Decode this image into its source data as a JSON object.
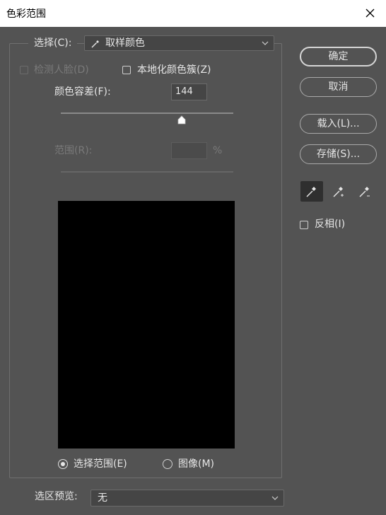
{
  "window": {
    "title": "色彩范围"
  },
  "select": {
    "label": "选择(C):",
    "value": "取样颜色"
  },
  "detect_faces": {
    "label": "检测人脸(D)",
    "checked": false,
    "enabled": false
  },
  "localized_clusters": {
    "label": "本地化颜色簇(Z)",
    "checked": false
  },
  "fuzziness": {
    "label": "颜色容差(F):",
    "value": "144",
    "fraction": 0.7
  },
  "range": {
    "label": "范围(R):",
    "value": "",
    "unit": "%",
    "enabled": false
  },
  "view_mode": {
    "options": [
      {
        "label": "选择范围(E)",
        "selected": true
      },
      {
        "label": "图像(M)",
        "selected": false
      }
    ]
  },
  "selection_preview": {
    "label": "选区预览:",
    "value": "无"
  },
  "buttons": {
    "ok": "确定",
    "cancel": "取消",
    "load": "载入(L)...",
    "save": "存储(S)..."
  },
  "eyedroppers": [
    "eyedropper-icon",
    "eyedropper-plus-icon",
    "eyedropper-minus-icon"
  ],
  "invert": {
    "label": "反相(I)",
    "checked": false
  }
}
